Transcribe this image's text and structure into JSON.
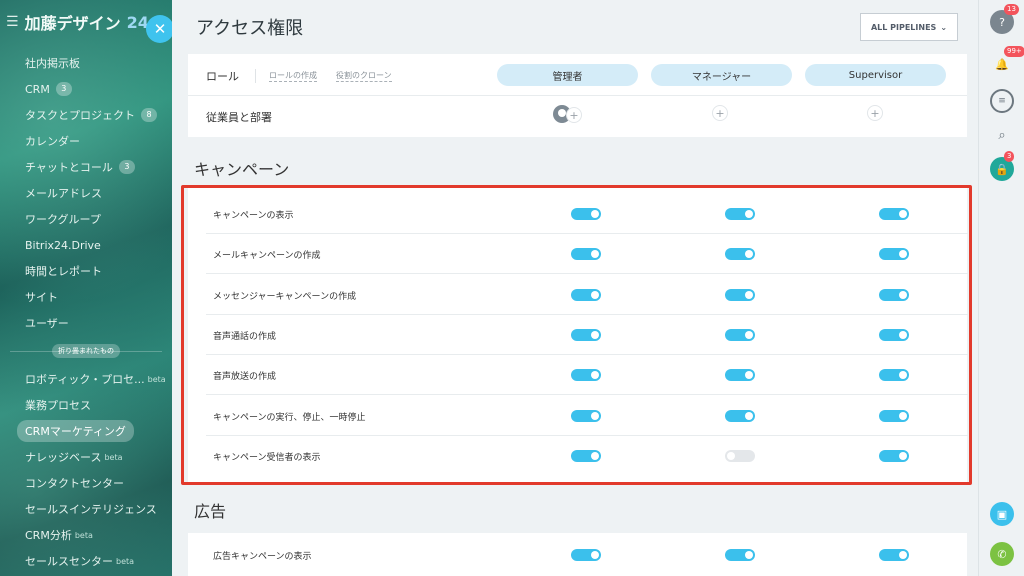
{
  "sidebar": {
    "brand": "加藤デザイン",
    "brand_suffix": "24",
    "items": [
      {
        "label": "社内掲示板",
        "badge": ""
      },
      {
        "label": "CRM",
        "badge": "3"
      },
      {
        "label": "タスクとプロジェクト",
        "badge": "8"
      },
      {
        "label": "カレンダー",
        "badge": ""
      },
      {
        "label": "チャットとコール",
        "badge": "3"
      },
      {
        "label": "メールアドレス",
        "badge": ""
      },
      {
        "label": "ワークグループ",
        "badge": ""
      },
      {
        "label": "Bitrix24.Drive",
        "badge": ""
      },
      {
        "label": "時間とレポート",
        "badge": ""
      },
      {
        "label": "サイト",
        "badge": ""
      },
      {
        "label": "ユーザー",
        "badge": ""
      }
    ],
    "divider": "折り畳まれたもの",
    "collapsed_items": [
      {
        "label": "ロボティック・プロセ...",
        "beta": "beta"
      },
      {
        "label": "業務プロセス",
        "beta": ""
      },
      {
        "label": "CRMマーケティング",
        "beta": ""
      },
      {
        "label": "ナレッジベース",
        "beta": "beta"
      },
      {
        "label": "コンタクトセンター",
        "beta": ""
      },
      {
        "label": "セールスインテリジェンス",
        "beta": ""
      },
      {
        "label": "CRM分析",
        "beta": "beta"
      },
      {
        "label": "セールスセンター",
        "beta": "beta"
      }
    ],
    "active_item": "CRMマーケティング"
  },
  "header": {
    "title": "アクセス権限",
    "pipelines_button": "ALL PIPELINES"
  },
  "roles": {
    "label": "ロール",
    "create_link": "ロールの作成",
    "clone_link": "役割のクローン",
    "columns": [
      "管理者",
      "マネージャー",
      "Supervisor"
    ],
    "employees_label": "従業員と部署"
  },
  "campaign_section": {
    "title": "キャンペーン",
    "rows": [
      {
        "label": "キャンペーンの表示",
        "values": [
          true,
          true,
          true
        ]
      },
      {
        "label": "メールキャンペーンの作成",
        "values": [
          true,
          true,
          true
        ]
      },
      {
        "label": "メッセンジャーキャンペーンの作成",
        "values": [
          true,
          true,
          true
        ]
      },
      {
        "label": "音声通話の作成",
        "values": [
          true,
          true,
          true
        ]
      },
      {
        "label": "音声放送の作成",
        "values": [
          true,
          true,
          true
        ]
      },
      {
        "label": "キャンペーンの実行、停止、一時停止",
        "values": [
          true,
          true,
          true
        ]
      },
      {
        "label": "キャンペーン受信者の表示",
        "values": [
          true,
          false,
          true
        ]
      }
    ]
  },
  "ads_section": {
    "title": "広告",
    "rows": [
      {
        "label": "広告キャンペーンの表示",
        "values": [
          true,
          true,
          true
        ]
      }
    ]
  },
  "rail": {
    "help_badge": "13",
    "notifications_badge": "99+",
    "lock_badge": "3"
  },
  "colors": {
    "accent": "#3bc0ec",
    "highlight": "#e23a2c",
    "badge": "#f3545c"
  }
}
